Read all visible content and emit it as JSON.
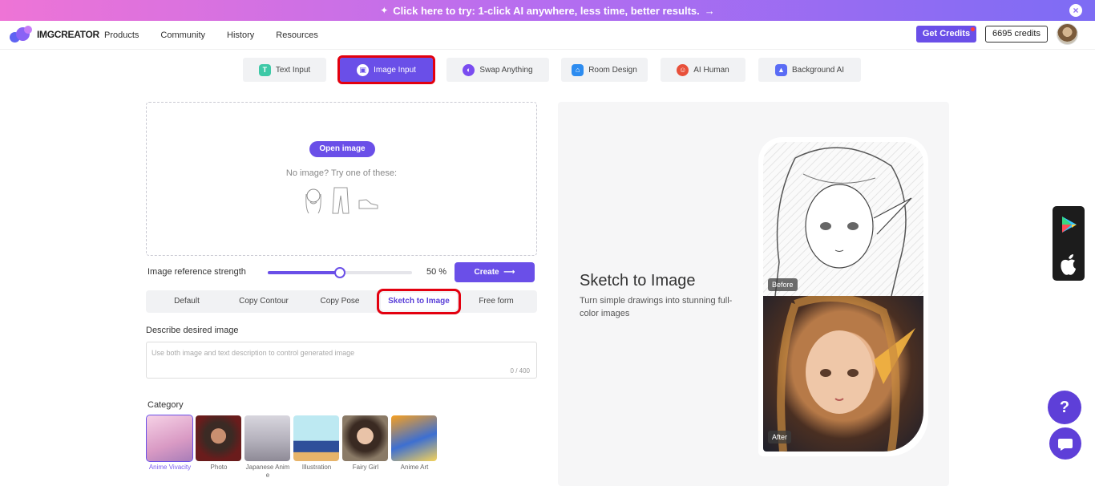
{
  "banner": {
    "text": "Click here to try: 1-click AI anywhere, less time, better results.",
    "arrow": "→",
    "close": "×"
  },
  "header": {
    "logo": "IMGCREATOR",
    "nav": [
      "Products",
      "Community",
      "History",
      "Resources"
    ],
    "get_credits": "Get Credits",
    "credits": "6695 credits"
  },
  "tabs": [
    {
      "label": "Text Input",
      "icon": "text-icon",
      "color": "#3ec9a7"
    },
    {
      "label": "Image Input",
      "icon": "image-icon",
      "color": "#ffffff",
      "active": true
    },
    {
      "label": "Swap Anything",
      "icon": "swap-icon",
      "color": "#7a4cf0"
    },
    {
      "label": "Room Design",
      "icon": "home-icon",
      "color": "#2d8cf0"
    },
    {
      "label": "AI Human",
      "icon": "human-icon",
      "color": "#e8503a"
    },
    {
      "label": "Background AI",
      "icon": "background-icon",
      "color": "#5a6cf5"
    }
  ],
  "upload": {
    "open_button": "Open image",
    "hint": "No image? Try one of these:",
    "samples": [
      "sketch-girl",
      "sketch-pants",
      "sketch-shoe"
    ]
  },
  "strength": {
    "label": "Image reference strength",
    "value": 50,
    "display": "50 %"
  },
  "create_button": "Create",
  "modes": [
    "Default",
    "Copy Contour",
    "Copy Pose",
    "Sketch to Image",
    "Free form"
  ],
  "active_mode": "Sketch to Image",
  "description": {
    "label": "Describe desired image",
    "placeholder": "Use both image and text description to control generated image",
    "counter": "0 / 400"
  },
  "category": {
    "label": "Category",
    "items": [
      "Anime Vivacity",
      "Photo",
      "Japanese Anime",
      "Illustration",
      "Fairy Girl",
      "Anime Art"
    ]
  },
  "preview": {
    "title": "Sketch to Image",
    "subtitle": "Turn simple drawings into stunning full-color images",
    "before_tag": "Before",
    "after_tag": "After"
  },
  "help": "?"
}
